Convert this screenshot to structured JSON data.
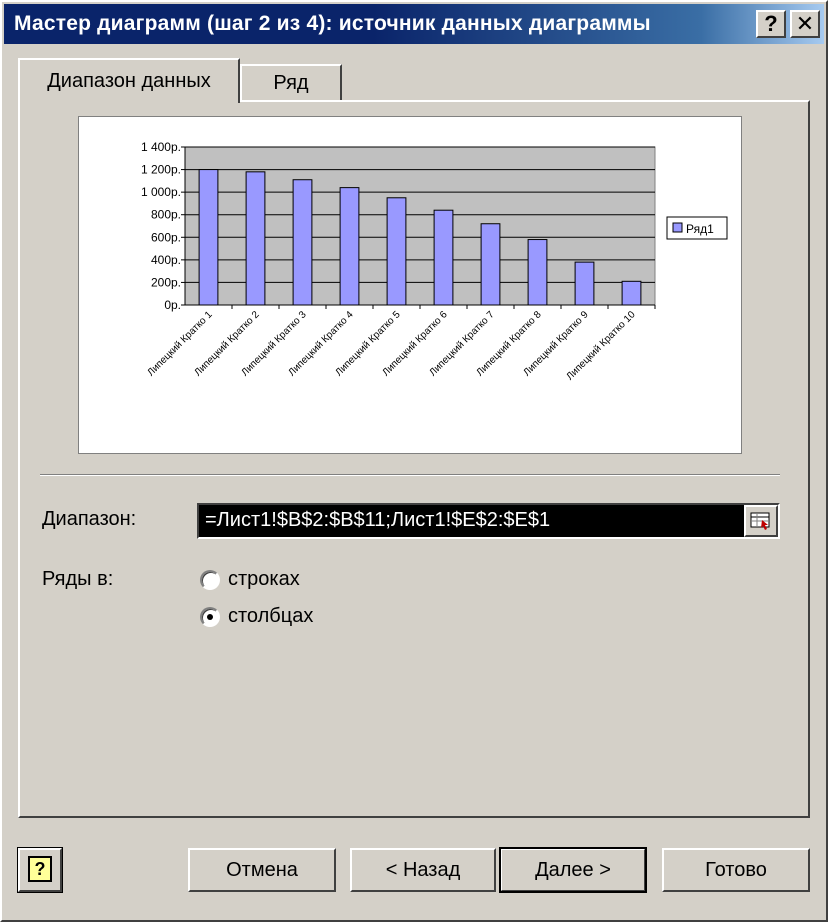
{
  "window": {
    "title": "Мастер диаграмм (шаг 2 из 4): источник данных диаграммы",
    "help_label": "?",
    "close_label": "✕"
  },
  "tabs": [
    {
      "label": "Диапазон данных",
      "active": true
    },
    {
      "label": "Ряд",
      "active": false
    }
  ],
  "chart_data": {
    "type": "bar",
    "categories": [
      "Липецкий Кратко 1",
      "Липецкий Кратко 2",
      "Липецкий Кратко 3",
      "Липецкий Кратко 4",
      "Липецкий Кратко 5",
      "Липецкий Кратко 6",
      "Липецкий Кратко 7",
      "Липецкий Кратко 8",
      "Липецкий Кратко 9",
      "Липецкий Кратко 10"
    ],
    "series": [
      {
        "name": "Ряд1",
        "values": [
          1200,
          1180,
          1110,
          1040,
          950,
          840,
          720,
          580,
          380,
          210
        ],
        "color": "#9999ff"
      }
    ],
    "yticks": [
      "0р.",
      "200р.",
      "400р.",
      "600р.",
      "800р.",
      "1 000р.",
      "1 200р.",
      "1 400р."
    ],
    "ylim": [
      0,
      1400
    ],
    "grid": true,
    "plot_background": "#c0c0c0",
    "legend_position": "right"
  },
  "form": {
    "range_label": "Диапазон:",
    "range_value": "=Лист1!$B$2:$B$11;Лист1!$E$2:$E$1",
    "series_in_label": "Ряды в:",
    "radio_rows": "строках",
    "radio_columns": "столбцах",
    "selected": "columns"
  },
  "buttons": {
    "cancel": "Отмена",
    "back": "< Назад",
    "next": "Далее >",
    "finish": "Готово"
  }
}
